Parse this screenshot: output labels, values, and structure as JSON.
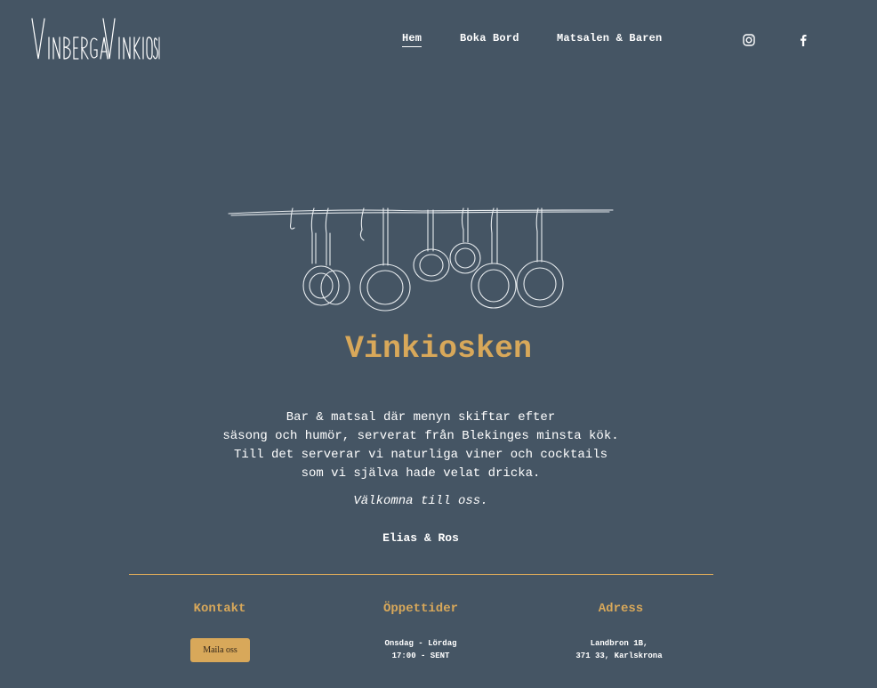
{
  "logo": {
    "text": "Vinberga Vinkiosk"
  },
  "nav": {
    "items": [
      {
        "label": "Hem",
        "active": true
      },
      {
        "label": "Boka Bord",
        "active": false
      },
      {
        "label": "Matsalen & Baren",
        "active": false
      }
    ],
    "social": [
      {
        "icon": "instagram-icon"
      },
      {
        "icon": "facebook-icon"
      }
    ]
  },
  "hero": {
    "illustration": "hanging-pans-icon",
    "title": "Vinkiosken",
    "intro_lines": [
      "Bar & matsal där menyn skiftar efter",
      "säsong och humör, serverat från Blekinges minsta kök.",
      "Till det serverar vi naturliga viner och cocktails",
      "som vi själva hade velat dricka."
    ],
    "welcome": "Välkomna till oss.",
    "signature": "Elias & Ros"
  },
  "footer": {
    "contact": {
      "heading": "Kontakt",
      "button": "Maila oss"
    },
    "hours": {
      "heading": "Öppettider",
      "lines": [
        "Onsdag - Lördag",
        "17:00 - SENT"
      ]
    },
    "address": {
      "heading": "Adress",
      "lines": [
        "Landbron 1B,",
        "371 33, Karlskrona"
      ]
    }
  },
  "colors": {
    "background": "#455564",
    "accent": "#d8a85a",
    "text": "#ffffff"
  }
}
